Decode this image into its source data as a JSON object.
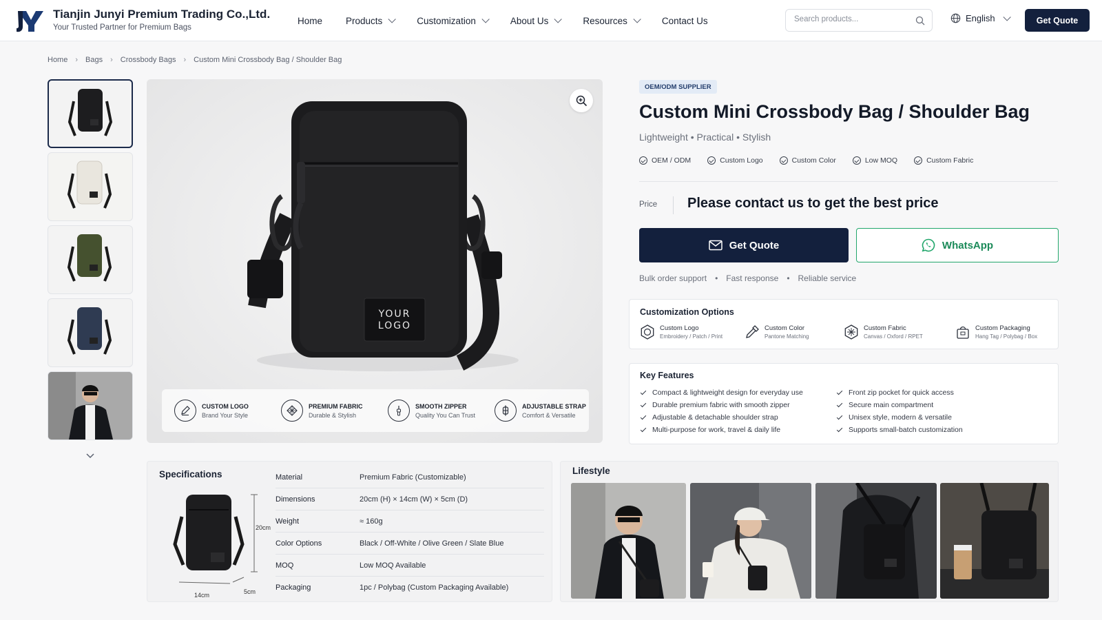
{
  "company": {
    "name": "Tianjin Junyi Premium Trading Co.,Ltd.",
    "tagline": "Your Trusted Partner for Premium Bags"
  },
  "nav": [
    {
      "label": "Home",
      "dropdown": false
    },
    {
      "label": "Products",
      "dropdown": true
    },
    {
      "label": "Customization",
      "dropdown": true
    },
    {
      "label": "About Us",
      "dropdown": true
    },
    {
      "label": "Resources",
      "dropdown": true
    },
    {
      "label": "Contact Us",
      "dropdown": false
    }
  ],
  "search": {
    "placeholder": "Search products..."
  },
  "language": "English",
  "header_cta": "Get Quote",
  "breadcrumb": [
    "Home",
    "Bags",
    "Crossbody Bags",
    "Custom Mini Crossbody Bag / Shoulder Bag"
  ],
  "thumbnails": [
    "black",
    "off-white",
    "olive-green",
    "slate-blue",
    "lifestyle"
  ],
  "main_image": {
    "logo_text": [
      "YOUR",
      "LOGO"
    ],
    "features": [
      {
        "title": "CUSTOM LOGO",
        "sub": "Brand Your Style",
        "icon": "pen-icon"
      },
      {
        "title": "PREMIUM FABRIC",
        "sub": "Durable & Stylish",
        "icon": "fabric-icon"
      },
      {
        "title": "SMOOTH ZIPPER",
        "sub": "Quality You Can Trust",
        "icon": "zipper-icon"
      },
      {
        "title": "ADJUSTABLE STRAP",
        "sub": "Comfort & Versatile",
        "icon": "buckle-icon"
      }
    ]
  },
  "product": {
    "badge": "OEM/ODM SUPPLIER",
    "title": "Custom Mini Crossbody Bag / Shoulder Bag",
    "subtitle": "Lightweight • Practical • Stylish",
    "tags": [
      "OEM / ODM",
      "Custom Logo",
      "Custom Color",
      "Low MOQ",
      "Custom Fabric"
    ],
    "price_label": "Price",
    "price_text": "Please contact us to get the best price",
    "quote_label": "Get Quote",
    "whatsapp_label": "WhatsApp",
    "service": [
      "Bulk order support",
      "Fast response",
      "Reliable service"
    ]
  },
  "customization": {
    "title": "Customization Options",
    "items": [
      {
        "name": "Custom Logo",
        "sub": "Embroidery / Patch / Print"
      },
      {
        "name": "Custom Color",
        "sub": "Pantone Matching"
      },
      {
        "name": "Custom Fabric",
        "sub": "Canvas / Oxford / RPET"
      },
      {
        "name": "Custom Packaging",
        "sub": "Hang Tag / Polybag / Box"
      }
    ]
  },
  "key_features": {
    "title": "Key Features",
    "left": [
      "Compact & lightweight design for everyday use",
      "Durable premium fabric with smooth zipper",
      "Adjustable & detachable shoulder strap",
      "Multi-purpose for work, travel & daily life"
    ],
    "right": [
      "Front zip pocket for quick access",
      "Secure main compartment",
      "Unisex style, modern & versatile",
      "Supports small-batch customization"
    ]
  },
  "specifications": {
    "title": "Specifications",
    "dims": {
      "height": "20cm",
      "width": "14cm",
      "depth": "5cm"
    },
    "rows": [
      {
        "k": "Material",
        "v": "Premium Fabric (Customizable)"
      },
      {
        "k": "Dimensions",
        "v": "20cm (H) × 14cm (W) × 5cm (D)"
      },
      {
        "k": "Weight",
        "v": "≈ 160g"
      },
      {
        "k": "Color Options",
        "v": "Black / Off-White / Olive Green / Slate Blue"
      },
      {
        "k": "MOQ",
        "v": "Low MOQ Available"
      },
      {
        "k": "Packaging",
        "v": "1pc / Polybag (Custom Packaging Available)"
      }
    ]
  },
  "lifestyle": {
    "title": "Lifestyle"
  },
  "colors": {
    "navy": "#13203d",
    "whatsapp": "#21a66b",
    "badge_bg": "#e3ebf6"
  }
}
